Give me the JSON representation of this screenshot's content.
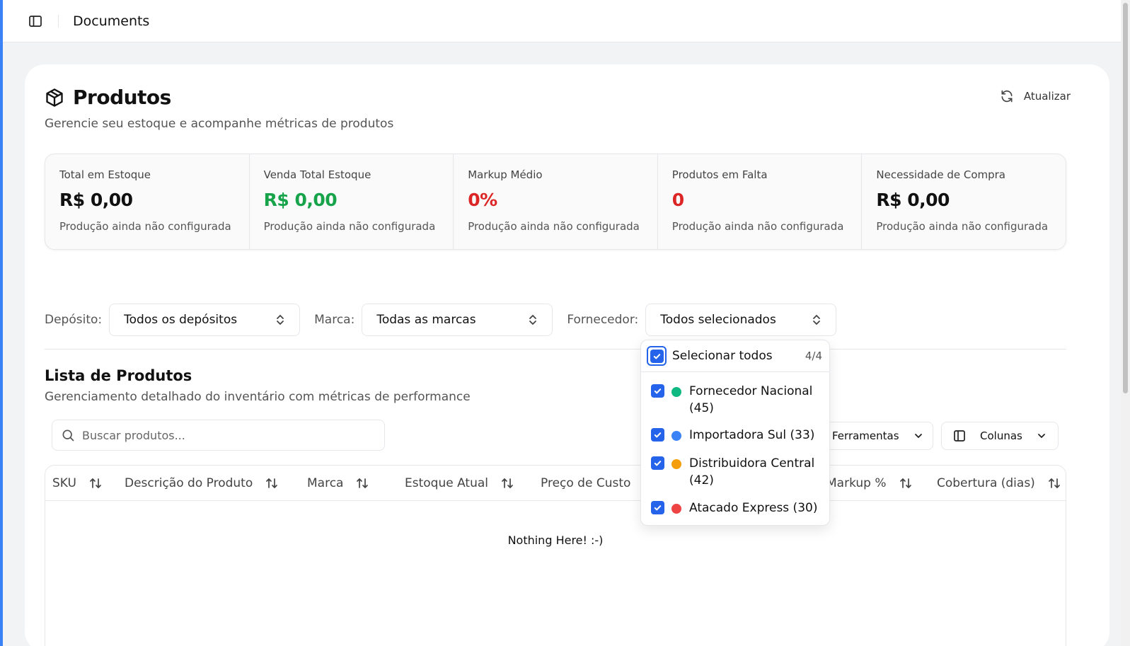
{
  "topbar": {
    "title": "Documents"
  },
  "header": {
    "title": "Produtos",
    "subtitle": "Gerencie seu estoque e acompanhe métricas de produtos",
    "refresh_label": "Atualizar"
  },
  "stats": [
    {
      "label": "Total em Estoque",
      "value": "R$ 0,00",
      "note": "Produção ainda não configurada",
      "color": "#111111"
    },
    {
      "label": "Venda Total Estoque",
      "value": "R$ 0,00",
      "note": "Produção ainda não configurada",
      "color": "#16a34a"
    },
    {
      "label": "Markup Médio",
      "value": "0%",
      "note": "Produção ainda não configurada",
      "color": "#dc2626"
    },
    {
      "label": "Produtos em Falta",
      "value": "0",
      "note": "Produção ainda não configurada",
      "color": "#dc2626"
    },
    {
      "label": "Necessidade de Compra",
      "value": "R$ 0,00",
      "note": "Produção ainda não configurada",
      "color": "#111111"
    }
  ],
  "filters": {
    "deposito": {
      "label": "Depósito:",
      "value": "Todos os depósitos"
    },
    "marca": {
      "label": "Marca:",
      "value": "Todas as marcas"
    },
    "fornecedor": {
      "label": "Fornecedor:",
      "value": "Todos selecionados"
    }
  },
  "list": {
    "title": "Lista de Produtos",
    "subtitle": "Gerenciamento detalhado do inventário com métricas de performance",
    "search_placeholder": "Buscar produtos...",
    "tools_label": "Ferramentas",
    "columns_label": "Colunas",
    "columns": [
      "SKU",
      "Descrição do Produto",
      "Marca",
      "Estoque Atual",
      "Preço de Custo",
      "Markup %",
      "Cobertura (dias)"
    ],
    "empty_text": "Nothing Here! :-)"
  },
  "supplier_dropdown": {
    "select_all_label": "Selecionar todos",
    "count": "4/4",
    "items": [
      {
        "line1": "Fornecedor Nacional",
        "line2": "(45)",
        "color": "#10b981"
      },
      {
        "line1": "Importadora Sul (33)",
        "line2": "",
        "color": "#3b82f6"
      },
      {
        "line1": "Distribuidora Central",
        "line2": "(42)",
        "color": "#f59e0b"
      },
      {
        "line1": "Atacado Express (30)",
        "line2": "",
        "color": "#ef4444"
      }
    ]
  }
}
